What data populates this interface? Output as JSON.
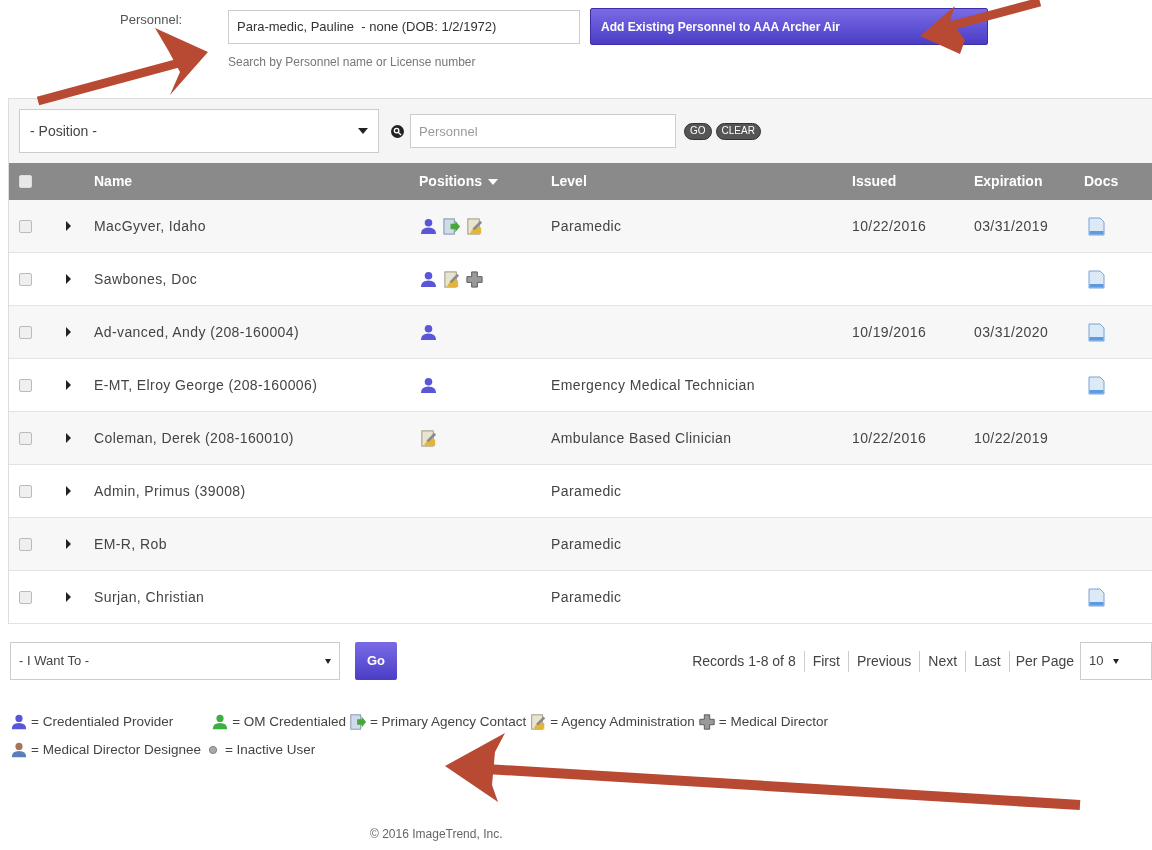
{
  "add_form": {
    "label": "Personnel:",
    "value": "Para-medic, Pauline  - none (DOB: 1/2/1972)",
    "hint": "Search by Personnel name or License number",
    "button": "Add Existing Personnel to AAA Archer Air"
  },
  "filters": {
    "position": "- Position -",
    "search_placeholder": "Personnel",
    "go": "GO",
    "clear": "CLEAR"
  },
  "table": {
    "select_all": {
      "checked": false
    },
    "columns": [
      "Name",
      "Positions",
      "Level",
      "Issued",
      "Expiration",
      "Docs"
    ],
    "rows": [
      {
        "checked": false,
        "name": "MacGyver, Idaho",
        "positions": [
          {
            "kind": "provider"
          },
          {
            "kind": "contact"
          },
          {
            "kind": "admin"
          }
        ],
        "level": "Paramedic",
        "issued": "10/22/2016",
        "expiration": "03/31/2019",
        "doc": true
      },
      {
        "checked": false,
        "name": "Sawbones, Doc",
        "positions": [
          {
            "kind": "provider"
          },
          {
            "kind": "admin"
          },
          {
            "kind": "director"
          }
        ],
        "doc": true
      },
      {
        "checked": false,
        "name": "Ad-vanced, Andy (208-160004)",
        "positions": [
          {
            "kind": "provider"
          }
        ],
        "issued": "10/19/2016",
        "expiration": "03/31/2020",
        "doc": true
      },
      {
        "checked": false,
        "name": "E-MT, Elroy George (208-160006)",
        "positions": [
          {
            "kind": "provider"
          }
        ],
        "level": "Emergency Medical Technician",
        "doc": true
      },
      {
        "checked": false,
        "name": "Coleman, Derek (208-160010)",
        "positions": [
          {
            "kind": "admin"
          }
        ],
        "level": "Ambulance Based Clinician",
        "issued": "10/22/2016",
        "expiration": "10/22/2019",
        "doc": false
      },
      {
        "checked": false,
        "name": "Admin, Primus (39008)",
        "positions": [],
        "level": "Paramedic",
        "doc": false
      },
      {
        "checked": false,
        "name": "EM-R, Rob",
        "positions": [],
        "level": "Paramedic",
        "doc": false
      },
      {
        "checked": false,
        "name": "Surjan, Christian",
        "positions": [],
        "level": "Paramedic",
        "doc": true
      }
    ]
  },
  "actions": {
    "select": "- I Want To -",
    "go": "Go"
  },
  "pagination": {
    "records": "Records 1-8 of 8",
    "links": [
      "First",
      "Previous",
      "Next",
      "Last"
    ],
    "per_page_label": "Per Page",
    "per_page": "10"
  },
  "legend": [
    {
      "kind": "provider",
      "label": "= Credentialed Provider"
    },
    {
      "kind": "om",
      "label": "= OM Credentialed"
    },
    {
      "kind": "contact",
      "label": "= Primary Agency Contact"
    },
    {
      "kind": "admin",
      "label": "= Agency Administration"
    },
    {
      "kind": "director",
      "label": "= Medical Director"
    },
    {
      "kind": "designee",
      "label": "= Medical Director Designee"
    },
    {
      "kind": "inactive",
      "label": "= Inactive User"
    }
  ],
  "footer": "© 2016 ImageTrend, Inc."
}
